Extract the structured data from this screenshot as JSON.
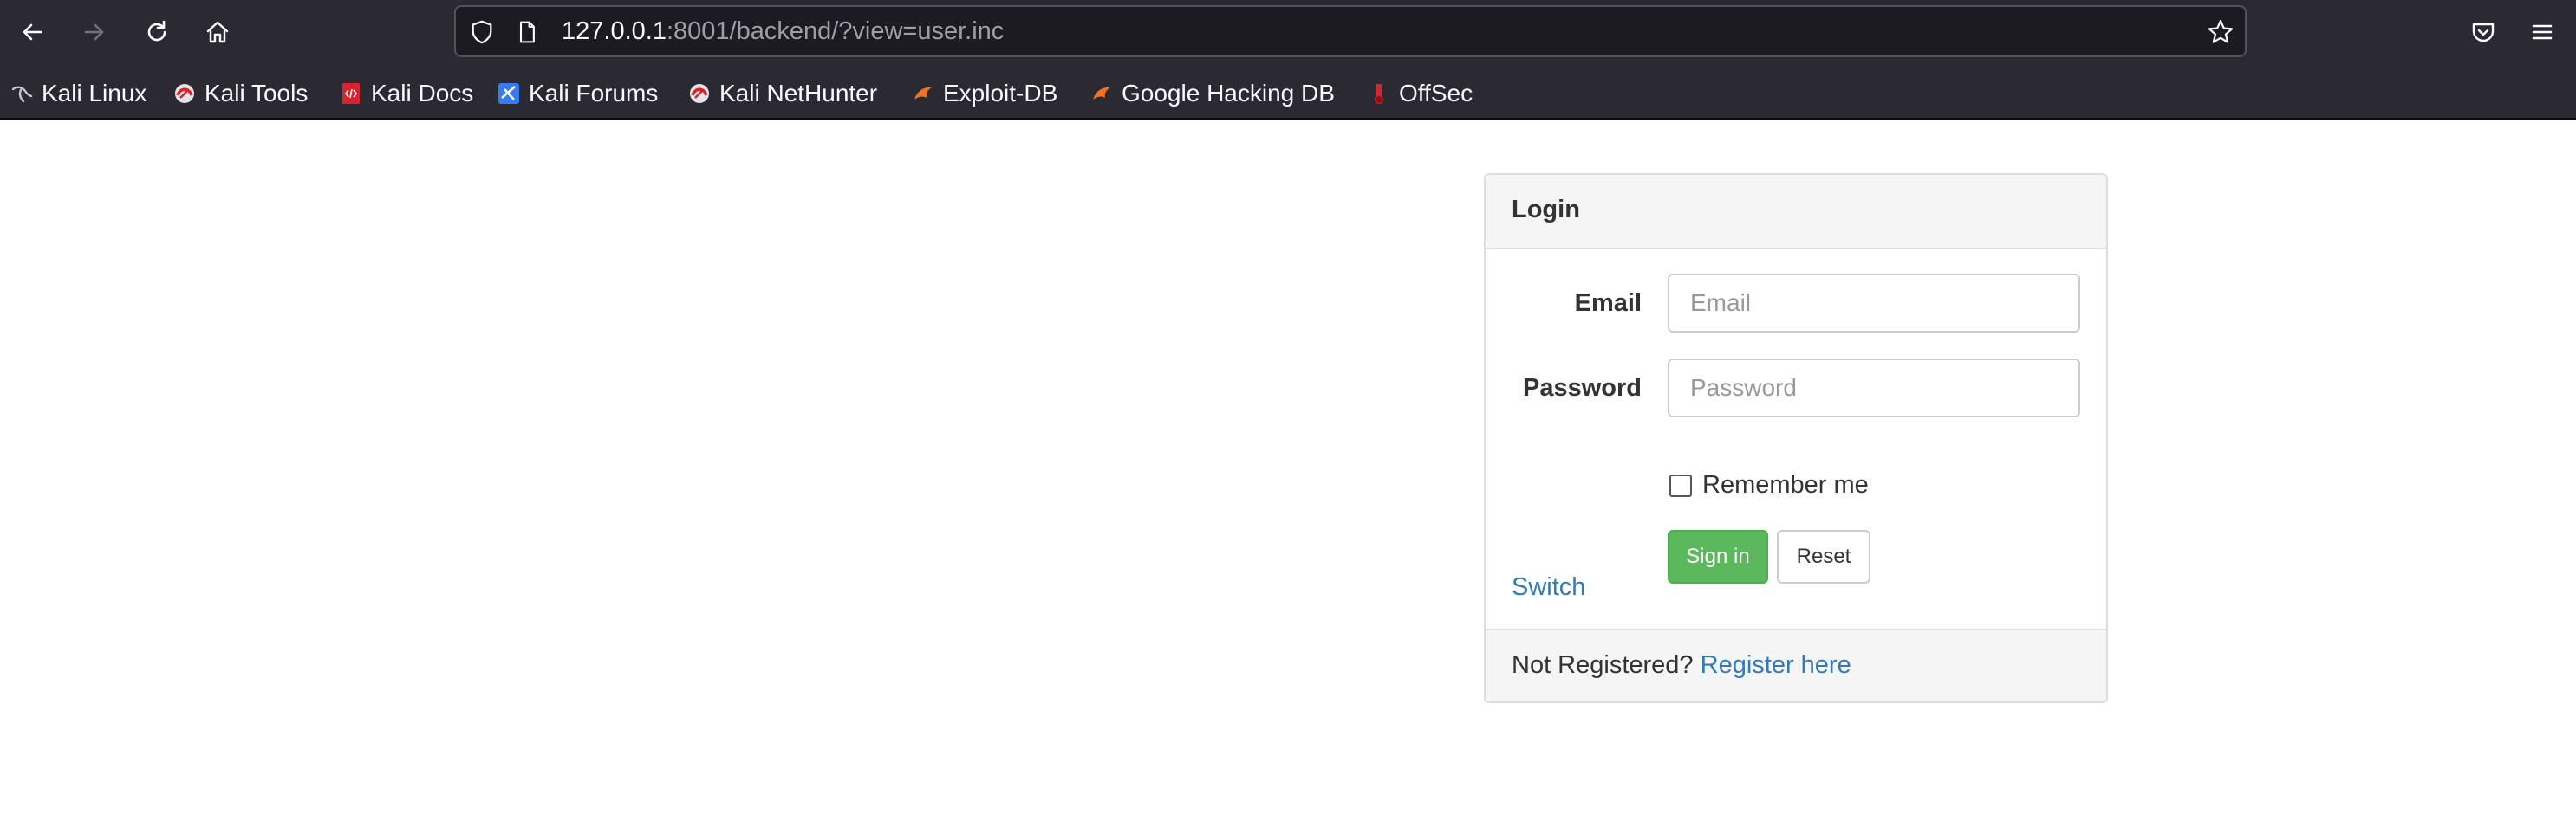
{
  "browser": {
    "url_host": "127.0.0.1",
    "url_rest": ":8001/backend/?view=user.inc",
    "bookmarks": [
      {
        "label": "Kali Linux",
        "icon": "kali-dragon-icon"
      },
      {
        "label": "Kali Tools",
        "icon": "kali-tools-icon"
      },
      {
        "label": "Kali Docs",
        "icon": "kali-docs-icon"
      },
      {
        "label": "Kali Forums",
        "icon": "kali-forums-icon"
      },
      {
        "label": "Kali NetHunter",
        "icon": "kali-nethunter-icon"
      },
      {
        "label": "Exploit-DB",
        "icon": "exploit-db-icon"
      },
      {
        "label": "Google Hacking DB",
        "icon": "google-hacking-db-icon"
      },
      {
        "label": "OffSec",
        "icon": "offsec-icon"
      }
    ]
  },
  "login": {
    "title": "Login",
    "email_label": "Email",
    "email_placeholder": "Email",
    "password_label": "Password",
    "password_placeholder": "Password",
    "remember_label": "Remember me",
    "remember_checked": false,
    "sign_in_label": "Sign in",
    "reset_label": "Reset",
    "switch_label": "Switch",
    "footer_text": "Not Registered?",
    "register_link": "Register here"
  },
  "colors": {
    "chrome_bg": "#2b2a33",
    "urlbar_bg": "#1c1b22",
    "link": "#337ab7",
    "success": "#5cb85c",
    "panel_bg": "#f5f5f5",
    "panel_border": "#dddddd"
  }
}
